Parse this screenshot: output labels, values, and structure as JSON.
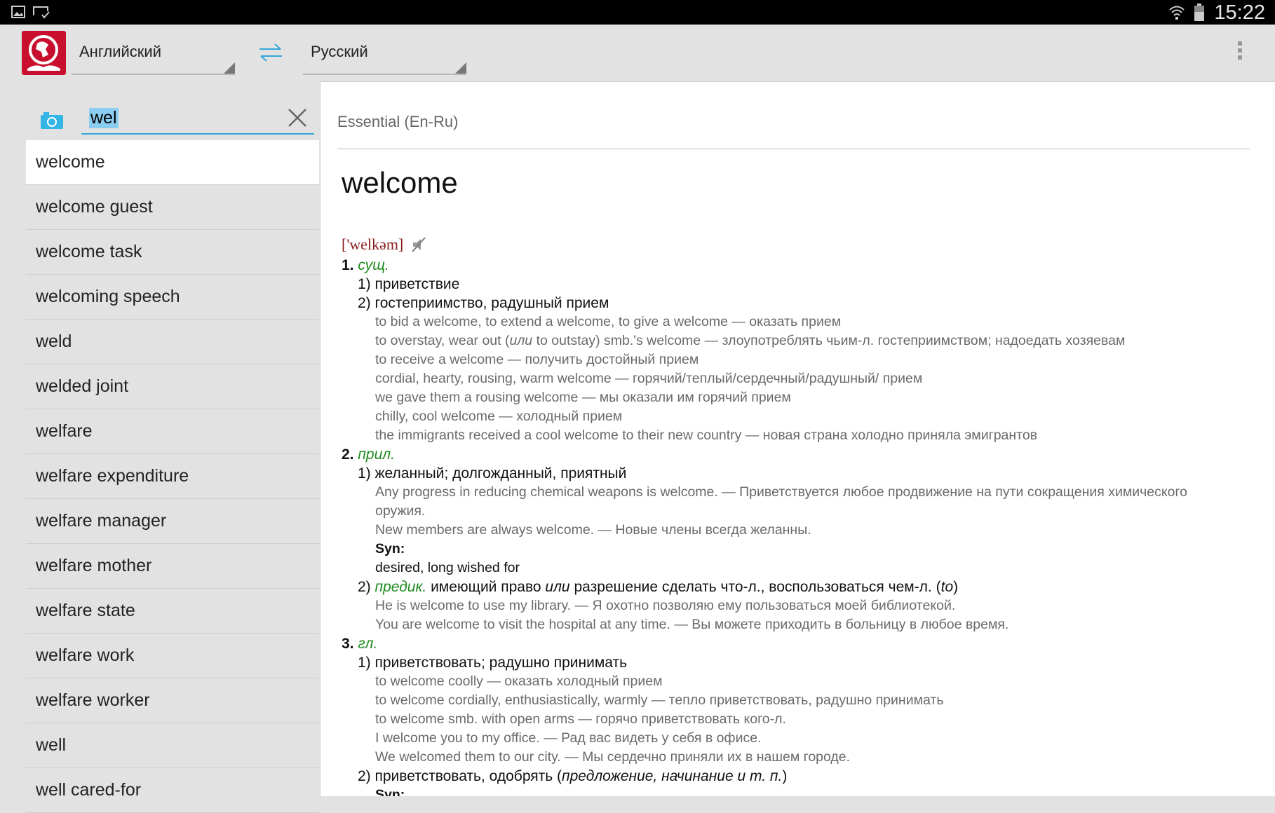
{
  "status_bar": {
    "time": "15:22",
    "icons": [
      "gallery-icon",
      "cast-icon",
      "wifi-icon",
      "battery-icon"
    ]
  },
  "toolbar": {
    "source_language": "Английский",
    "target_language": "Русский",
    "swap_icon": "swap-arrows-icon",
    "menu_icon": "overflow-menu-icon"
  },
  "search": {
    "value": "wel",
    "camera_icon": "camera-icon",
    "clear_icon": "close-icon"
  },
  "word_list": [
    "welcome",
    "welcome guest",
    "welcome task",
    "welcoming speech",
    "weld",
    "welded joint",
    "welfare",
    "welfare expenditure",
    "welfare manager",
    "welfare mother",
    "welfare state",
    "welfare work",
    "welfare worker",
    "well",
    "well cared-for"
  ],
  "selected_word": "welcome",
  "article": {
    "dictionary": "Essential (En-Ru)",
    "headword": "welcome",
    "lines": [
      {
        "k": "phon",
        "p": [
          {
            "t": "['welkəm]",
            "c": "ph"
          }
        ]
      },
      {
        "k": "num",
        "p": [
          {
            "t": "1. ",
            "c": "b"
          },
          {
            "t": "сущ.",
            "c": "pos"
          }
        ]
      },
      {
        "k": "sub",
        "p": [
          {
            "t": "1) приветствие"
          }
        ]
      },
      {
        "k": "sub",
        "p": [
          {
            "t": "2) гостеприимство, радушный прием"
          }
        ]
      },
      {
        "k": "ex",
        "p": [
          {
            "t": "to bid a welcome, to extend a welcome, to give a welcome — оказать прием"
          }
        ]
      },
      {
        "k": "ex",
        "p": [
          {
            "t": "to overstay, wear out ("
          },
          {
            "t": "или",
            "c": "it"
          },
          {
            "t": " to outstay) smb.'s welcome — злоупотреблять чьим-л. гостеприимством; надоедать хозяевам"
          }
        ]
      },
      {
        "k": "ex",
        "p": [
          {
            "t": "to receive a welcome — получить достойный прием"
          }
        ]
      },
      {
        "k": "ex",
        "p": [
          {
            "t": "cordial, hearty, rousing, warm welcome — горячий/теплый/сердечный/радушный/ прием"
          }
        ]
      },
      {
        "k": "ex",
        "p": [
          {
            "t": "we gave them a rousing welcome — мы оказали им горячий прием"
          }
        ]
      },
      {
        "k": "ex",
        "p": [
          {
            "t": "chilly, cool welcome — холодный прием"
          }
        ]
      },
      {
        "k": "ex",
        "p": [
          {
            "t": "the immigrants received a cool welcome to their new country — новая страна холодно приняла эмигрантов"
          }
        ]
      },
      {
        "k": "num",
        "p": [
          {
            "t": "2. ",
            "c": "b"
          },
          {
            "t": "прил.",
            "c": "pos"
          }
        ]
      },
      {
        "k": "sub",
        "p": [
          {
            "t": "1) желанный; долгожданный, приятный"
          }
        ]
      },
      {
        "k": "ex",
        "p": [
          {
            "t": "Any progress in reducing chemical weapons is welcome. — Приветствуется любое продвижение на пути сокращения химического"
          }
        ]
      },
      {
        "k": "ex",
        "p": [
          {
            "t": "оружия."
          }
        ]
      },
      {
        "k": "ex",
        "p": [
          {
            "t": "New members are always welcome. — Новые члены всегда желанны."
          }
        ]
      },
      {
        "k": "exb",
        "p": [
          {
            "t": "Syn:",
            "c": "b"
          }
        ]
      },
      {
        "k": "exb",
        "p": [
          {
            "t": "desired, long wished for"
          }
        ]
      },
      {
        "k": "sub",
        "p": [
          {
            "t": "2) "
          },
          {
            "t": "предик.",
            "c": "pos"
          },
          {
            "t": " имеющий право "
          },
          {
            "t": "или",
            "c": "it"
          },
          {
            "t": " разрешение сделать что-л., воспользоваться чем-л. ("
          },
          {
            "t": "to",
            "c": "it"
          },
          {
            "t": ")"
          }
        ]
      },
      {
        "k": "ex",
        "p": [
          {
            "t": "He is welcome to use my library. — Я охотно позволяю ему пользоваться моей библиотекой."
          }
        ]
      },
      {
        "k": "ex",
        "p": [
          {
            "t": "You are welcome to visit the hospital at any time. — Вы можете приходить в больницу в любое время."
          }
        ]
      },
      {
        "k": "num",
        "p": [
          {
            "t": "3. ",
            "c": "b"
          },
          {
            "t": "гл.",
            "c": "pos"
          }
        ]
      },
      {
        "k": "sub",
        "p": [
          {
            "t": "1) приветствовать; радушно принимать"
          }
        ]
      },
      {
        "k": "ex",
        "p": [
          {
            "t": "to welcome coolly — оказать холодный прием"
          }
        ]
      },
      {
        "k": "ex",
        "p": [
          {
            "t": "to welcome cordially, enthusiastically, warmly — тепло приветствовать, радушно принимать"
          }
        ]
      },
      {
        "k": "ex",
        "p": [
          {
            "t": "to welcome smb. with open arms — горячо приветствовать кого-л."
          }
        ]
      },
      {
        "k": "ex",
        "p": [
          {
            "t": "I welcome you to my office. — Рад вас видеть у себя в офисе."
          }
        ]
      },
      {
        "k": "ex",
        "p": [
          {
            "t": "We welcomed them to our city. — Мы сердечно приняли их в нашем городе."
          }
        ]
      },
      {
        "k": "sub",
        "p": [
          {
            "t": "2) приветствовать, одобрять ("
          },
          {
            "t": "предложение, начинание и т. п.",
            "c": "it"
          },
          {
            "t": ")"
          }
        ]
      },
      {
        "k": "exb",
        "p": [
          {
            "t": "Syn:",
            "c": "b"
          }
        ]
      }
    ]
  },
  "colors": {
    "accent": "#33a7d8",
    "logo": "#c8102e",
    "part_of_speech": "#1f8a1f",
    "transcription": "#8b1a1a"
  }
}
